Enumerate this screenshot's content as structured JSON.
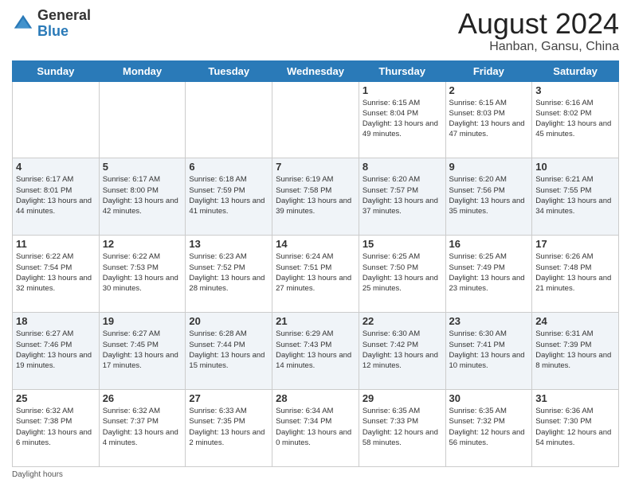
{
  "header": {
    "logo": {
      "general": "General",
      "blue": "Blue"
    },
    "title": "August 2024",
    "location": "Hanban, Gansu, China"
  },
  "weekdays": [
    "Sunday",
    "Monday",
    "Tuesday",
    "Wednesday",
    "Thursday",
    "Friday",
    "Saturday"
  ],
  "weeks": [
    [
      {
        "day": "",
        "info": ""
      },
      {
        "day": "",
        "info": ""
      },
      {
        "day": "",
        "info": ""
      },
      {
        "day": "",
        "info": ""
      },
      {
        "day": "1",
        "info": "Sunrise: 6:15 AM\nSunset: 8:04 PM\nDaylight: 13 hours\nand 49 minutes."
      },
      {
        "day": "2",
        "info": "Sunrise: 6:15 AM\nSunset: 8:03 PM\nDaylight: 13 hours\nand 47 minutes."
      },
      {
        "day": "3",
        "info": "Sunrise: 6:16 AM\nSunset: 8:02 PM\nDaylight: 13 hours\nand 45 minutes."
      }
    ],
    [
      {
        "day": "4",
        "info": "Sunrise: 6:17 AM\nSunset: 8:01 PM\nDaylight: 13 hours\nand 44 minutes."
      },
      {
        "day": "5",
        "info": "Sunrise: 6:17 AM\nSunset: 8:00 PM\nDaylight: 13 hours\nand 42 minutes."
      },
      {
        "day": "6",
        "info": "Sunrise: 6:18 AM\nSunset: 7:59 PM\nDaylight: 13 hours\nand 41 minutes."
      },
      {
        "day": "7",
        "info": "Sunrise: 6:19 AM\nSunset: 7:58 PM\nDaylight: 13 hours\nand 39 minutes."
      },
      {
        "day": "8",
        "info": "Sunrise: 6:20 AM\nSunset: 7:57 PM\nDaylight: 13 hours\nand 37 minutes."
      },
      {
        "day": "9",
        "info": "Sunrise: 6:20 AM\nSunset: 7:56 PM\nDaylight: 13 hours\nand 35 minutes."
      },
      {
        "day": "10",
        "info": "Sunrise: 6:21 AM\nSunset: 7:55 PM\nDaylight: 13 hours\nand 34 minutes."
      }
    ],
    [
      {
        "day": "11",
        "info": "Sunrise: 6:22 AM\nSunset: 7:54 PM\nDaylight: 13 hours\nand 32 minutes."
      },
      {
        "day": "12",
        "info": "Sunrise: 6:22 AM\nSunset: 7:53 PM\nDaylight: 13 hours\nand 30 minutes."
      },
      {
        "day": "13",
        "info": "Sunrise: 6:23 AM\nSunset: 7:52 PM\nDaylight: 13 hours\nand 28 minutes."
      },
      {
        "day": "14",
        "info": "Sunrise: 6:24 AM\nSunset: 7:51 PM\nDaylight: 13 hours\nand 27 minutes."
      },
      {
        "day": "15",
        "info": "Sunrise: 6:25 AM\nSunset: 7:50 PM\nDaylight: 13 hours\nand 25 minutes."
      },
      {
        "day": "16",
        "info": "Sunrise: 6:25 AM\nSunset: 7:49 PM\nDaylight: 13 hours\nand 23 minutes."
      },
      {
        "day": "17",
        "info": "Sunrise: 6:26 AM\nSunset: 7:48 PM\nDaylight: 13 hours\nand 21 minutes."
      }
    ],
    [
      {
        "day": "18",
        "info": "Sunrise: 6:27 AM\nSunset: 7:46 PM\nDaylight: 13 hours\nand 19 minutes."
      },
      {
        "day": "19",
        "info": "Sunrise: 6:27 AM\nSunset: 7:45 PM\nDaylight: 13 hours\nand 17 minutes."
      },
      {
        "day": "20",
        "info": "Sunrise: 6:28 AM\nSunset: 7:44 PM\nDaylight: 13 hours\nand 15 minutes."
      },
      {
        "day": "21",
        "info": "Sunrise: 6:29 AM\nSunset: 7:43 PM\nDaylight: 13 hours\nand 14 minutes."
      },
      {
        "day": "22",
        "info": "Sunrise: 6:30 AM\nSunset: 7:42 PM\nDaylight: 13 hours\nand 12 minutes."
      },
      {
        "day": "23",
        "info": "Sunrise: 6:30 AM\nSunset: 7:41 PM\nDaylight: 13 hours\nand 10 minutes."
      },
      {
        "day": "24",
        "info": "Sunrise: 6:31 AM\nSunset: 7:39 PM\nDaylight: 13 hours\nand 8 minutes."
      }
    ],
    [
      {
        "day": "25",
        "info": "Sunrise: 6:32 AM\nSunset: 7:38 PM\nDaylight: 13 hours\nand 6 minutes."
      },
      {
        "day": "26",
        "info": "Sunrise: 6:32 AM\nSunset: 7:37 PM\nDaylight: 13 hours\nand 4 minutes."
      },
      {
        "day": "27",
        "info": "Sunrise: 6:33 AM\nSunset: 7:35 PM\nDaylight: 13 hours\nand 2 minutes."
      },
      {
        "day": "28",
        "info": "Sunrise: 6:34 AM\nSunset: 7:34 PM\nDaylight: 13 hours\nand 0 minutes."
      },
      {
        "day": "29",
        "info": "Sunrise: 6:35 AM\nSunset: 7:33 PM\nDaylight: 12 hours\nand 58 minutes."
      },
      {
        "day": "30",
        "info": "Sunrise: 6:35 AM\nSunset: 7:32 PM\nDaylight: 12 hours\nand 56 minutes."
      },
      {
        "day": "31",
        "info": "Sunrise: 6:36 AM\nSunset: 7:30 PM\nDaylight: 12 hours\nand 54 minutes."
      }
    ]
  ],
  "footer": {
    "daylight_hours": "Daylight hours"
  }
}
